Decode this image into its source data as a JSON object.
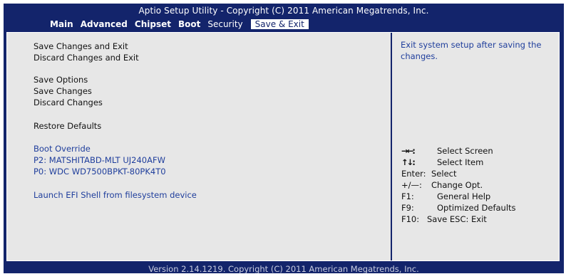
{
  "header": {
    "title": "Aptio Setup Utility - Copyright (C) 2011 American Megatrends, Inc.",
    "tabs": [
      {
        "label": "Main"
      },
      {
        "label": "Advanced"
      },
      {
        "label": "Chipset"
      },
      {
        "label": "Boot"
      },
      {
        "label": "Security"
      },
      {
        "label": "Save & Exit"
      }
    ],
    "selected_tab": "Save & Exit"
  },
  "menu": {
    "save_changes_exit": "Save Changes and Exit",
    "discard_changes_exit": "Discard Changes and Exit",
    "save_options": "Save Options",
    "save_changes": "Save Changes",
    "discard_changes": "Discard Changes",
    "restore_defaults": "Restore Defaults",
    "boot_override": "Boot Override",
    "boot_p2": "P2:  MATSHITABD-MLT UJ240AFW",
    "boot_p0": "P0:  WDC WD7500BPKT-80PK4T0",
    "launch_efi": "Launch EFI Shell from filesystem device"
  },
  "help_text": "Exit system setup after saving the changes.",
  "keys": [
    {
      "key": "→←:",
      "desc": "Select Screen"
    },
    {
      "key": "↑↓:",
      "desc": "Select Item"
    },
    {
      "key": "Enter:",
      "desc": "Select"
    },
    {
      "key": "+/—:",
      "desc": "Change Opt."
    },
    {
      "key": "F1:",
      "desc": "General Help"
    },
    {
      "key": "F9:",
      "desc": "Optimized Defaults"
    },
    {
      "key": "F10:",
      "desc": "Save   ESC: Exit"
    }
  ],
  "footer": {
    "version": "Version 2.14.1219. Copyright (C) 2011 American Megatrends, Inc."
  },
  "colors": {
    "frame_blue": "#13246b",
    "panel_gray": "#e7e7e7",
    "highlight_blue": "#1f3e9c",
    "text_dark": "#111111"
  }
}
